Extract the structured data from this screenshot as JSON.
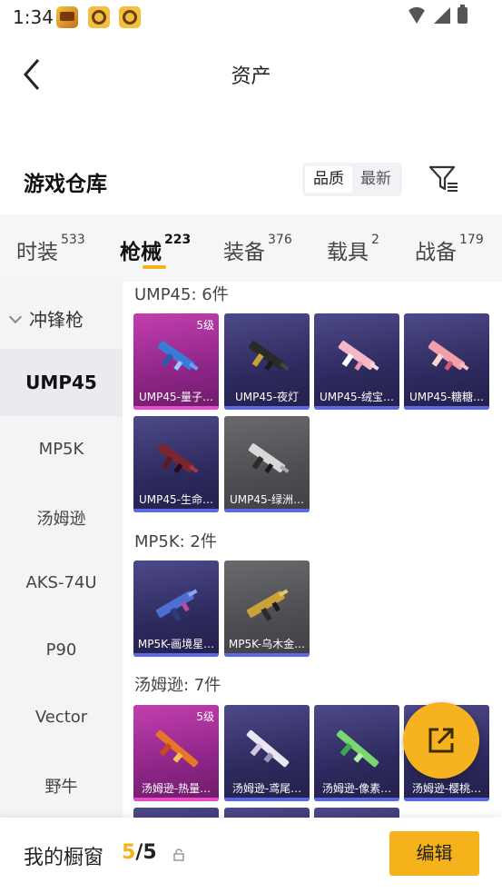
{
  "status": {
    "time": "1:34"
  },
  "header": {
    "title": "资产"
  },
  "warehouse": {
    "title": "游戏仓库",
    "sort": {
      "quality": "品质",
      "newest": "最新"
    }
  },
  "tabs": [
    {
      "label": "时装",
      "count": "533"
    },
    {
      "label": "枪械",
      "count": "223"
    },
    {
      "label": "装备",
      "count": "376"
    },
    {
      "label": "载具",
      "count": "2"
    },
    {
      "label": "战备",
      "count": "179"
    }
  ],
  "categories": {
    "group": "冲锋枪",
    "items": [
      "UMP45",
      "MP5K",
      "汤姆逊",
      "AKS-74U",
      "P90",
      "Vector",
      "野牛"
    ]
  },
  "sections": [
    {
      "title": "UMP45: 6件",
      "items": [
        {
          "name": "UMP45-量子…",
          "level": "5级"
        },
        {
          "name": "UMP45-夜灯"
        },
        {
          "name": "UMP45-绒宝…"
        },
        {
          "name": "UMP45-糖糖…"
        },
        {
          "name": "UMP45-生命…"
        },
        {
          "name": "UMP45-绿洲…"
        }
      ]
    },
    {
      "title": "MP5K: 2件",
      "items": [
        {
          "name": "MP5K-画境星…"
        },
        {
          "name": "MP5K-乌木金…"
        }
      ]
    },
    {
      "title": "汤姆逊: 7件",
      "items": [
        {
          "name": "汤姆逊-热量…",
          "level": "5级"
        },
        {
          "name": "汤姆逊-鸢尾…"
        },
        {
          "name": "汤姆逊-像素…"
        },
        {
          "name": "汤姆逊-樱桃…"
        }
      ]
    }
  ],
  "bottom": {
    "label": "我的橱窗",
    "current": "5",
    "total": "/5",
    "edit": "编辑"
  }
}
